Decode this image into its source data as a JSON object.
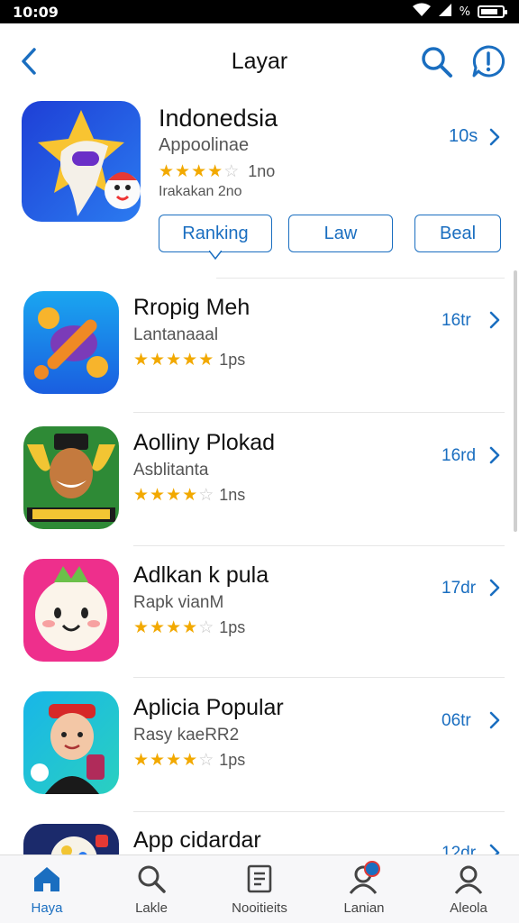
{
  "status_bar": {
    "time": "10:09",
    "battery_label": "%"
  },
  "nav": {
    "title": "Layar"
  },
  "featured": {
    "name": "Indonedsia",
    "subtitle": "Appoolinae",
    "rating": 4,
    "rating_text": "1no",
    "meta": "Irakakan 2no",
    "size": "10s",
    "tabs": [
      "Ranking",
      "Law",
      "Beal"
    ]
  },
  "apps": [
    {
      "name": "Rropig Meh",
      "subtitle": "Lantanaaal",
      "rating": 5,
      "rating_text": "1ps",
      "size": "16tr"
    },
    {
      "name": "Aolliny Plokad",
      "subtitle": "Asblitanta",
      "rating": 4,
      "rating_text": "1ns",
      "size": "16rd"
    },
    {
      "name": "Adlkan k pula",
      "subtitle": "Rapk vianM",
      "rating": 4,
      "rating_text": "1ps",
      "size": "17dr"
    },
    {
      "name": "Aplicia Popular",
      "subtitle": "Rasy kaeRR2",
      "rating": 4,
      "rating_text": "1ps",
      "size": "06tr"
    },
    {
      "name": "App cidardar",
      "subtitle": "",
      "rating": 0,
      "rating_text": "",
      "size": "12dr"
    }
  ],
  "bottom_nav": [
    {
      "label": "Haya",
      "icon": "home-icon",
      "active": true
    },
    {
      "label": "Lakle",
      "icon": "search-icon",
      "active": false
    },
    {
      "label": "Nooitieits",
      "icon": "document-icon",
      "active": false
    },
    {
      "label": "Lanian",
      "icon": "user-badge-icon",
      "active": false
    },
    {
      "label": "Aleola",
      "icon": "profile-icon",
      "active": false
    }
  ],
  "colors": {
    "accent": "#1a6ec0",
    "star": "#f2a900"
  }
}
